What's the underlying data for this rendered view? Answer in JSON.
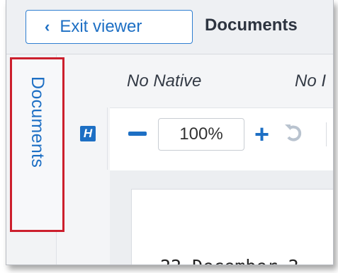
{
  "header": {
    "exit_label": "Exit viewer",
    "title": "Documents"
  },
  "sidebar": {
    "documents_tab_label": "Documents"
  },
  "viewer": {
    "native_label": "No Native",
    "image_label": "No I",
    "highlight_icon_label": "H",
    "zoom_value": "100%",
    "page_text": "22 December 2"
  },
  "colors": {
    "accent": "#1d6fc4",
    "highlight_border": "#cc1f2d"
  },
  "icons": {
    "exit": "chevron-left-icon",
    "zoom_out": "minus-icon",
    "zoom_in": "plus-icon",
    "rotate": "rotate-left-icon",
    "highlight": "highlight-h-icon"
  }
}
